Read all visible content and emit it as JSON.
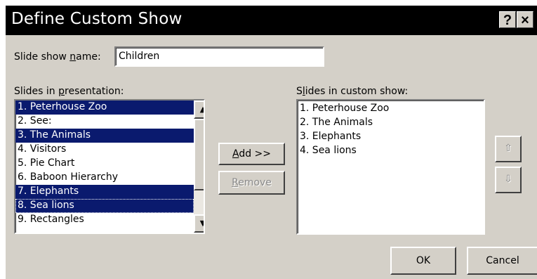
{
  "window": {
    "title": "Define Custom Show",
    "help_label": "?",
    "close_label": "×"
  },
  "name_field": {
    "label_pre": "Slide show ",
    "label_key": "n",
    "label_post": "ame:",
    "value": "Children"
  },
  "left_list": {
    "label_pre": "Slides in ",
    "label_key": "p",
    "label_post": "resentation:",
    "items": [
      {
        "label": "1. Peterhouse Zoo",
        "selected": true
      },
      {
        "label": "2. See:",
        "selected": false
      },
      {
        "label": "3. The Animals",
        "selected": true
      },
      {
        "label": "4. Visitors",
        "selected": false
      },
      {
        "label": "5. Pie Chart",
        "selected": false
      },
      {
        "label": "6. Baboon Hierarchy",
        "selected": false
      },
      {
        "label": "7. Elephants",
        "selected": true
      },
      {
        "label": "8. Sea lions",
        "selected": true,
        "focused": true
      },
      {
        "label": "9. Rectangles",
        "selected": false
      }
    ]
  },
  "right_list": {
    "label_pre": "S",
    "label_key": "l",
    "label_post": "ides in custom show:",
    "items": [
      "1. Peterhouse Zoo",
      "2. The Animals",
      "3. Elephants",
      "4. Sea lions"
    ]
  },
  "buttons": {
    "add_key": "A",
    "add_rest": "dd >>",
    "remove_key": "R",
    "remove_rest": "emove",
    "ok": "OK",
    "cancel": "Cancel"
  },
  "icons": {
    "scroll_up": "▲",
    "scroll_down": "▼",
    "move_up": "⇧",
    "move_down": "⇩"
  },
  "colors": {
    "selection": "#0a1a6e",
    "dialog_bg": "#d4d0c8",
    "title_bar": "#000000"
  }
}
